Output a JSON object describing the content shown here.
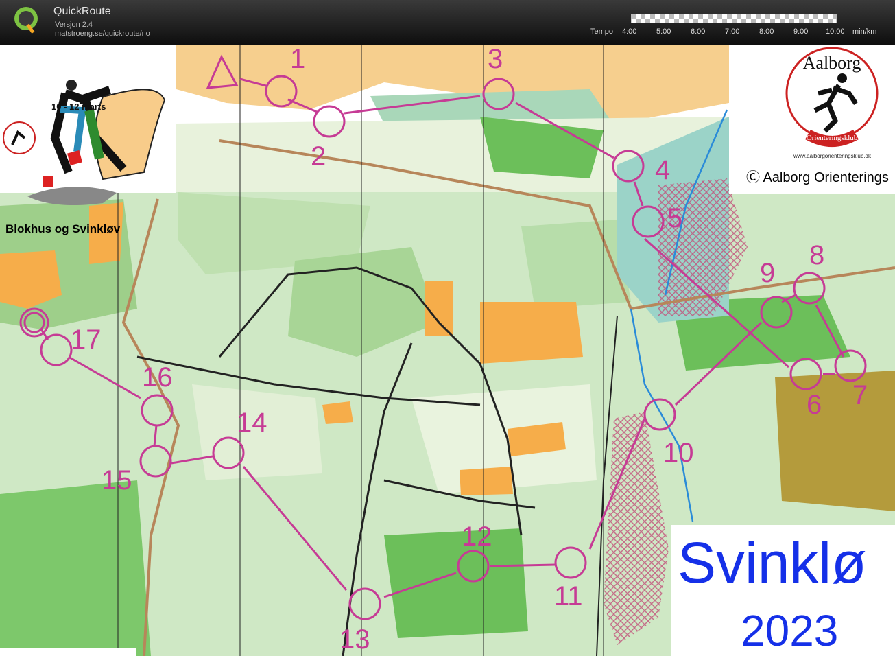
{
  "app": {
    "title": "QuickRoute",
    "version": "Versjon 2.4",
    "url": "matstroeng.se/quickroute/no",
    "logo_icon": "quickroute-q-logo"
  },
  "tempo": {
    "label": "Tempo",
    "ticks": [
      "4:00",
      "5:00",
      "6:00",
      "7:00",
      "8:00",
      "9:00",
      "10:00"
    ],
    "unit": "min/km"
  },
  "map": {
    "event_dates": "10 - 12 marts",
    "event_name": "Blokhus og Svinkløv",
    "club_url": "www.aalborgorienteringsklub.dk",
    "copyright": "Ⓒ Aalborg Orienterings",
    "title": "Svinklø",
    "year": "2023",
    "course_color": "#c63b95",
    "controls": [
      "1",
      "2",
      "3",
      "4",
      "5",
      "6",
      "7",
      "8",
      "9",
      "10",
      "11",
      "12",
      "13",
      "14",
      "15",
      "16",
      "17"
    ]
  },
  "club_logo": {
    "name_top": "Aalborg",
    "name_bottom": "Orienteringsklub"
  }
}
